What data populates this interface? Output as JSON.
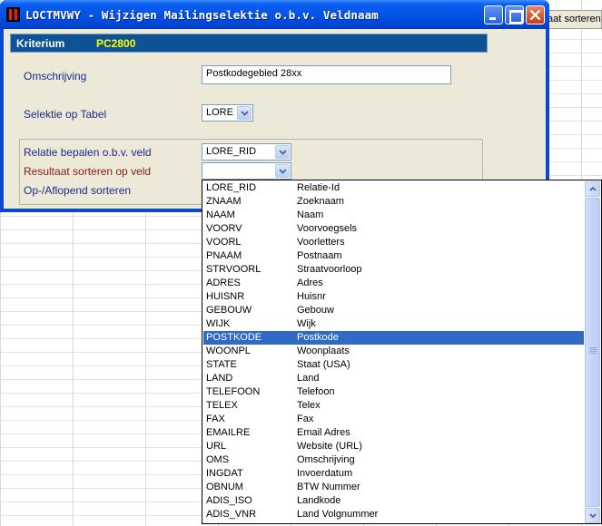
{
  "background": {
    "column_header_text": "aat sorteren"
  },
  "window": {
    "title": "LOCTMVWY - Wijzigen Mailingselektie o.b.v. Veldnaam",
    "controls": {
      "minimize": "minimize-icon",
      "maximize": "maximize-icon",
      "close": "close-icon"
    }
  },
  "kriterium": {
    "label": "Kriterium",
    "value": "PC2800"
  },
  "form": {
    "omschrijving_label": "Omschrijving",
    "omschrijving_value": "Postkodegebied 28xx",
    "selektie_label": "Selektie op Tabel",
    "selektie_value": "LORE",
    "relatie_label": "Relatie bepalen o.b.v. veld",
    "relatie_value": "LORE_RID",
    "resultaat_label": "Resultaat sorteren op veld",
    "resultaat_value": "",
    "opaflopend_label": "Op-/Aflopend sorteren"
  },
  "colors": {
    "title_bar": "#0454e6",
    "kriterium_bar": "#0c5294",
    "kriterium_value": "#ffff00",
    "label_navy": "#1b2a8c",
    "label_maroon": "#8b1a1a",
    "selection": "#316ac5"
  },
  "dropdown": {
    "selected_index": 11,
    "items": [
      {
        "code": "LORE_RID",
        "desc": "Relatie-Id"
      },
      {
        "code": "ZNAAM",
        "desc": "Zoeknaam"
      },
      {
        "code": "NAAM",
        "desc": "Naam"
      },
      {
        "code": "VOORV",
        "desc": "Voorvoegsels"
      },
      {
        "code": "VOORL",
        "desc": "Voorletters"
      },
      {
        "code": "PNAAM",
        "desc": "Postnaam"
      },
      {
        "code": "STRVOORL",
        "desc": "Straatvoorloop"
      },
      {
        "code": "ADRES",
        "desc": "Adres"
      },
      {
        "code": "HUISNR",
        "desc": "Huisnr"
      },
      {
        "code": "GEBOUW",
        "desc": "Gebouw"
      },
      {
        "code": "WIJK",
        "desc": "Wijk"
      },
      {
        "code": "POSTKODE",
        "desc": "Postkode"
      },
      {
        "code": "WOONPL",
        "desc": "Woonplaats"
      },
      {
        "code": "STATE",
        "desc": "Staat (USA)"
      },
      {
        "code": "LAND",
        "desc": "Land"
      },
      {
        "code": "TELEFOON",
        "desc": "Telefoon"
      },
      {
        "code": "TELEX",
        "desc": "Telex"
      },
      {
        "code": "FAX",
        "desc": "Fax"
      },
      {
        "code": "EMAILRE",
        "desc": "Email Adres"
      },
      {
        "code": "URL",
        "desc": "Website (URL)"
      },
      {
        "code": "OMS",
        "desc": "Omschrijving"
      },
      {
        "code": "INGDAT",
        "desc": "Invoerdatum"
      },
      {
        "code": "OBNUM",
        "desc": "BTW Nummer"
      },
      {
        "code": "ADIS_ISO",
        "desc": "Landkode"
      },
      {
        "code": "ADIS_VNR",
        "desc": "Land Volgnummer"
      }
    ]
  }
}
